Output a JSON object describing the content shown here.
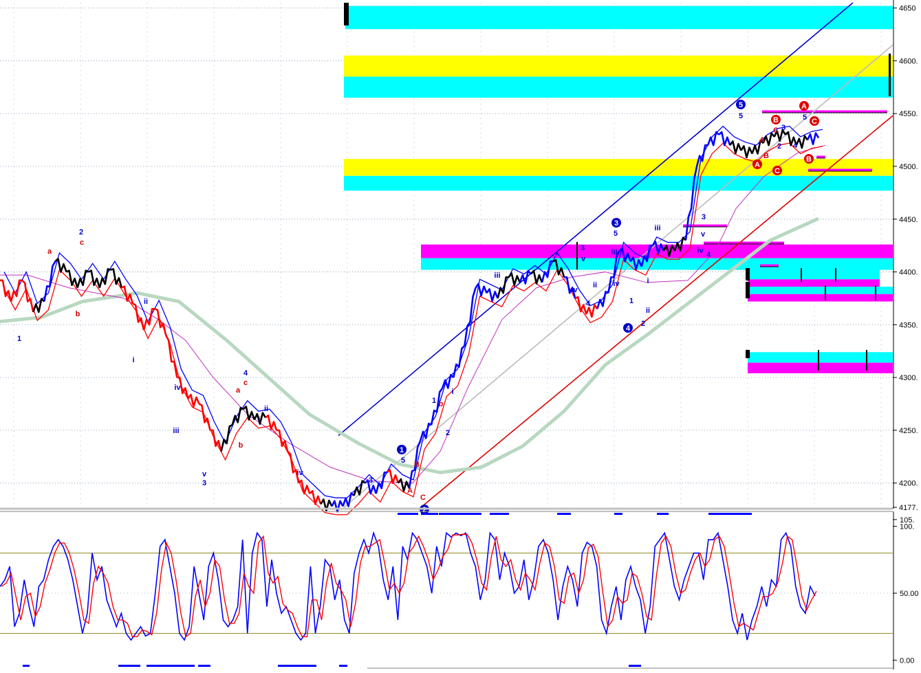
{
  "chart_data": [
    {
      "type": "line",
      "panel": "price",
      "ylim": [
        4177,
        4655
      ],
      "y_ticks": [
        "4650",
        "4600.",
        "4550.",
        "4500.",
        "4450.",
        "4400.",
        "4350.",
        "4300.",
        "4250.",
        "4200.",
        "4177."
      ],
      "grid": true,
      "series_colors": {
        "price_up": "#0000ff",
        "price_down": "#ff0000",
        "price_neutral": "#000000",
        "moving_average_short": "#c030c0",
        "moving_average_long": "#b8d8c0",
        "channel_upper": "#0000cc",
        "channel_lower": "#dd0000",
        "channel_mid": "#bbbbbb"
      },
      "zones": [
        {
          "color": "#00ffff",
          "y_from": 4630,
          "y_to": 4652
        },
        {
          "color": "#ffff00",
          "y_from": 4585,
          "y_to": 4605
        },
        {
          "color": "#00ffff",
          "y_from": 4565,
          "y_to": 4585
        },
        {
          "color": "#ffff00",
          "y_from": 4491,
          "y_to": 4507
        },
        {
          "color": "#00ffff",
          "y_from": 4477,
          "y_to": 4491
        },
        {
          "color": "#ff00ff",
          "y_from": 4413,
          "y_to": 4426
        },
        {
          "color": "#00ffff",
          "y_from": 4402,
          "y_to": 4413
        },
        {
          "color": "#00ffff",
          "y_from": 4393,
          "y_to": 4403
        },
        {
          "color": "#ff00ff",
          "y_from": 4385,
          "y_to": 4393
        },
        {
          "color": "#00ffff",
          "y_from": 4379,
          "y_to": 4386
        },
        {
          "color": "#ff00ff",
          "y_from": 4372,
          "y_to": 4379
        },
        {
          "color": "#00ffff",
          "y_from": 4314,
          "y_to": 4324
        },
        {
          "color": "#ff00ff",
          "y_from": 4304,
          "y_to": 4314
        }
      ],
      "price_path": [
        [
          4392,
          "#ff0000"
        ],
        [
          4372,
          "#ff0000"
        ],
        [
          4392,
          "#ff0000"
        ],
        [
          4362,
          "#ff0000"
        ],
        [
          4372,
          "#000000"
        ],
        [
          4410,
          "#0000ff"
        ],
        [
          4400,
          "#000000"
        ],
        [
          4385,
          "#000000"
        ],
        [
          4400,
          "#000000"
        ],
        [
          4385,
          "#000000"
        ],
        [
          4402,
          "#000000"
        ],
        [
          4385,
          "#000000"
        ],
        [
          4370,
          "#ff0000"
        ],
        [
          4345,
          "#ff0000"
        ],
        [
          4365,
          "#ff0000"
        ],
        [
          4340,
          "#ff0000"
        ],
        [
          4300,
          "#ff0000"
        ],
        [
          4280,
          "#ff0000"
        ],
        [
          4275,
          "#ff0000"
        ],
        [
          4250,
          "#ff0000"
        ],
        [
          4230,
          "#ff0000"
        ],
        [
          4255,
          "#000000"
        ],
        [
          4270,
          "#000000"
        ],
        [
          4260,
          "#000000"
        ],
        [
          4262,
          "#000000"
        ],
        [
          4250,
          "#ff0000"
        ],
        [
          4230,
          "#ff0000"
        ],
        [
          4200,
          "#ff0000"
        ],
        [
          4190,
          "#ff0000"
        ],
        [
          4180,
          "#ff0000"
        ],
        [
          4178,
          "#000000"
        ],
        [
          4178,
          "#0000ff"
        ],
        [
          4188,
          "#0000ff"
        ],
        [
          4200,
          "#000000"
        ],
        [
          4190,
          "#0000ff"
        ],
        [
          4210,
          "#0000ff"
        ],
        [
          4200,
          "#ff0000"
        ],
        [
          4195,
          "#000000"
        ],
        [
          4240,
          "#0000ff"
        ],
        [
          4255,
          "#0000ff"
        ],
        [
          4290,
          "#0000ff"
        ],
        [
          4300,
          "#0000ff"
        ],
        [
          4330,
          "#0000ff"
        ],
        [
          4385,
          "#0000ff"
        ],
        [
          4380,
          "#0000ff"
        ],
        [
          4375,
          "#0000ff"
        ],
        [
          4395,
          "#000000"
        ],
        [
          4390,
          "#000000"
        ],
        [
          4398,
          "#0000ff"
        ],
        [
          4390,
          "#000000"
        ],
        [
          4410,
          "#0000ff"
        ],
        [
          4395,
          "#000000"
        ],
        [
          4375,
          "#0000ff"
        ],
        [
          4360,
          "#ff0000"
        ],
        [
          4365,
          "#ff0000"
        ],
        [
          4380,
          "#0000ff"
        ],
        [
          4420,
          "#0000ff"
        ],
        [
          4410,
          "#0000ff"
        ],
        [
          4405,
          "#0000ff"
        ],
        [
          4425,
          "#0000ff"
        ],
        [
          4420,
          "#0000ff"
        ],
        [
          4420,
          "#000000"
        ],
        [
          4430,
          "#000000"
        ],
        [
          4500,
          "#0000ff"
        ],
        [
          4520,
          "#0000ff"
        ],
        [
          4530,
          "#0000ff"
        ],
        [
          4520,
          "#0000ff"
        ],
        [
          4515,
          "#000000"
        ],
        [
          4512,
          "#000000"
        ],
        [
          4522,
          "#000000"
        ],
        [
          4528,
          "#000000"
        ],
        [
          4530,
          "#000000"
        ],
        [
          4520,
          "#000000"
        ],
        [
          4525,
          "#000000"
        ],
        [
          4527,
          "#0000ff"
        ]
      ],
      "channel_upper": {
        "from": 4245,
        "to": 4655
      },
      "channel_lower": {
        "from": 4177,
        "to": 4548
      },
      "channel_mid": {
        "from": 4177,
        "to": 4615
      },
      "wave_labels": [
        {
          "text": "1",
          "color": "#0000cc"
        },
        {
          "text": "a",
          "color": "#cc0000"
        },
        {
          "text": "2",
          "color": "#0000cc"
        },
        {
          "text": "c",
          "color": "#cc0000"
        },
        {
          "text": "b",
          "color": "#cc0000"
        },
        {
          "text": "ii",
          "color": "#0000cc"
        },
        {
          "text": "i",
          "color": "#0000cc"
        },
        {
          "text": "iv",
          "color": "#0000cc"
        },
        {
          "text": "iii",
          "color": "#0000cc"
        },
        {
          "text": "v",
          "color": "#0000cc"
        },
        {
          "text": "3",
          "color": "#0000cc"
        },
        {
          "text": "a",
          "color": "#cc0000"
        },
        {
          "text": "b",
          "color": "#cc0000"
        },
        {
          "text": "4",
          "color": "#0000cc"
        },
        {
          "text": "c",
          "color": "#cc0000"
        },
        {
          "text": "ii",
          "color": "#0000cc"
        },
        {
          "text": "i",
          "color": "#0000cc"
        },
        {
          "text": "iv",
          "color": "#0000cc"
        },
        {
          "text": "3",
          "color": "#0000cc"
        },
        {
          "text": "5",
          "color": "#0000cc"
        },
        {
          "text": "A",
          "color": "#cc0000"
        },
        {
          "text": "B",
          "color": "#cc0000"
        },
        {
          "text": "C",
          "color": "#cc0000"
        },
        {
          "text": "1",
          "color": "#0000cc"
        },
        {
          "text": "b",
          "color": "#cc0000"
        },
        {
          "text": "2",
          "color": "#0000cc"
        },
        {
          "text": "i",
          "color": "#0000cc"
        },
        {
          "text": "iii",
          "color": "#0000cc"
        },
        {
          "text": "3",
          "color": "#0000cc"
        },
        {
          "text": "v",
          "color": "#0000cc"
        },
        {
          "text": "iv",
          "color": "#0000cc"
        },
        {
          "text": "4",
          "color": "#0000cc"
        },
        {
          "text": "iii",
          "color": "#0000cc"
        },
        {
          "text": "ii",
          "color": "#0000cc"
        },
        {
          "text": "iv",
          "color": "#0000cc"
        },
        {
          "text": "5",
          "color": "#0000cc"
        },
        {
          "text": "1",
          "color": "#0000cc"
        },
        {
          "text": "ii",
          "color": "#0000cc"
        },
        {
          "text": "i",
          "color": "#0000cc"
        },
        {
          "text": "2",
          "color": "#0000cc"
        },
        {
          "text": "iii",
          "color": "#0000cc"
        },
        {
          "text": "3",
          "color": "#0000cc"
        },
        {
          "text": "iv",
          "color": "#0000cc"
        },
        {
          "text": "4",
          "color": "#0000cc"
        },
        {
          "text": "v",
          "color": "#0000cc"
        },
        {
          "text": "5",
          "color": "#0000cc"
        },
        {
          "text": "A",
          "color": "#cc0000"
        },
        {
          "text": "B",
          "color": "#cc0000"
        },
        {
          "text": "C",
          "color": "#cc0000"
        },
        {
          "text": "3",
          "color": "#0000cc"
        },
        {
          "text": "2",
          "color": "#0000cc"
        },
        {
          "text": "5",
          "color": "#0000cc"
        },
        {
          "text": "4",
          "color": "#0000cc"
        }
      ],
      "circled_labels": [
        {
          "text": "1",
          "fill": "#0000cc"
        },
        {
          "text": "2",
          "fill": "#0000cc"
        },
        {
          "text": "3",
          "fill": "#0000cc"
        },
        {
          "text": "4",
          "fill": "#0000cc"
        },
        {
          "text": "5",
          "fill": "#0000cc"
        },
        {
          "text": "A",
          "fill": "#dd0000"
        },
        {
          "text": "C",
          "fill": "#dd0000"
        },
        {
          "text": "B",
          "fill": "#dd0000"
        },
        {
          "text": "A",
          "fill": "#dd0000"
        },
        {
          "text": "C",
          "fill": "#dd0000"
        },
        {
          "text": "B",
          "fill": "#dd0000"
        }
      ]
    },
    {
      "type": "line",
      "panel": "oscillator",
      "ylim": [
        -5,
        108
      ],
      "y_ticks": [
        "105.",
        "100.",
        "50.00",
        "0.00"
      ],
      "reference_levels": [
        80,
        20
      ],
      "series_colors": {
        "fast": "#0000ff",
        "slow": "#ff0000"
      },
      "values": [
        55,
        60,
        70,
        25,
        35,
        60,
        40,
        25,
        55,
        60,
        75,
        85,
        90,
        85,
        75,
        60,
        40,
        20,
        35,
        80,
        60,
        70,
        45,
        35,
        25,
        35,
        20,
        15,
        20,
        25,
        18,
        20,
        50,
        85,
        90,
        70,
        50,
        20,
        15,
        25,
        70,
        50,
        30,
        70,
        80,
        60,
        30,
        25,
        30,
        40,
        90,
        20,
        80,
        95,
        90,
        40,
        75,
        50,
        35,
        40,
        30,
        20,
        15,
        20,
        70,
        20,
        40,
        75,
        70,
        45,
        60,
        30,
        20,
        65,
        80,
        90,
        80,
        95,
        85,
        60,
        45,
        70,
        30,
        85,
        75,
        95,
        90,
        80,
        70,
        50,
        85,
        70,
        95,
        92,
        95,
        93,
        95,
        80,
        70,
        45,
        60,
        95,
        90,
        60,
        80,
        70,
        50,
        55,
        75,
        45,
        60,
        85,
        90,
        80,
        60,
        30,
        55,
        70,
        60,
        40,
        80,
        88,
        85,
        70,
        30,
        20,
        40,
        55,
        30,
        60,
        70,
        55,
        45,
        20,
        40,
        85,
        90,
        95,
        75,
        55,
        45,
        60,
        70,
        80,
        80,
        60,
        90,
        90,
        95,
        75,
        55,
        30,
        20,
        35,
        15,
        30,
        40,
        55,
        40,
        60,
        55,
        90,
        95,
        85,
        55,
        40,
        35,
        55,
        48
      ]
    }
  ]
}
